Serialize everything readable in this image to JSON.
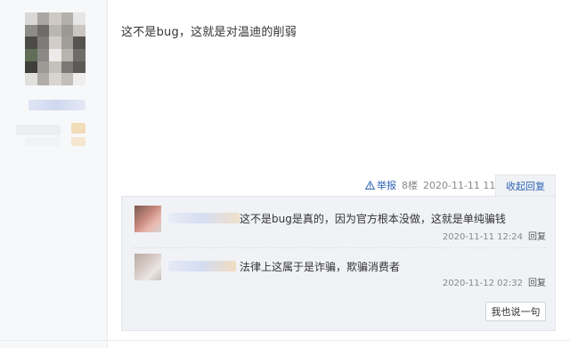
{
  "post": {
    "content": "这不是bug，这就是对温迪的削弱",
    "report_label": "举报",
    "floor": "8楼",
    "time": "2020-11-11 11:34",
    "collapse_label": "收起回复"
  },
  "replies": [
    {
      "text": "这不是bug是真的，因为官方根本没做，这就是单纯骗钱",
      "time": "2020-11-11 12:24",
      "reply_label": "回复"
    },
    {
      "text": "法律上这属于是诈骗，欺骗消费者",
      "time": "2020-11-12 02:32",
      "reply_label": "回复"
    }
  ],
  "reply_box": {
    "say_button": "我也说一句"
  },
  "colors": {
    "link": "#2d64b3",
    "reply_bg": "#f0f2f5",
    "sidebar_bg": "#f7f8fa"
  },
  "icons": {
    "report": "warning-triangle-icon"
  }
}
